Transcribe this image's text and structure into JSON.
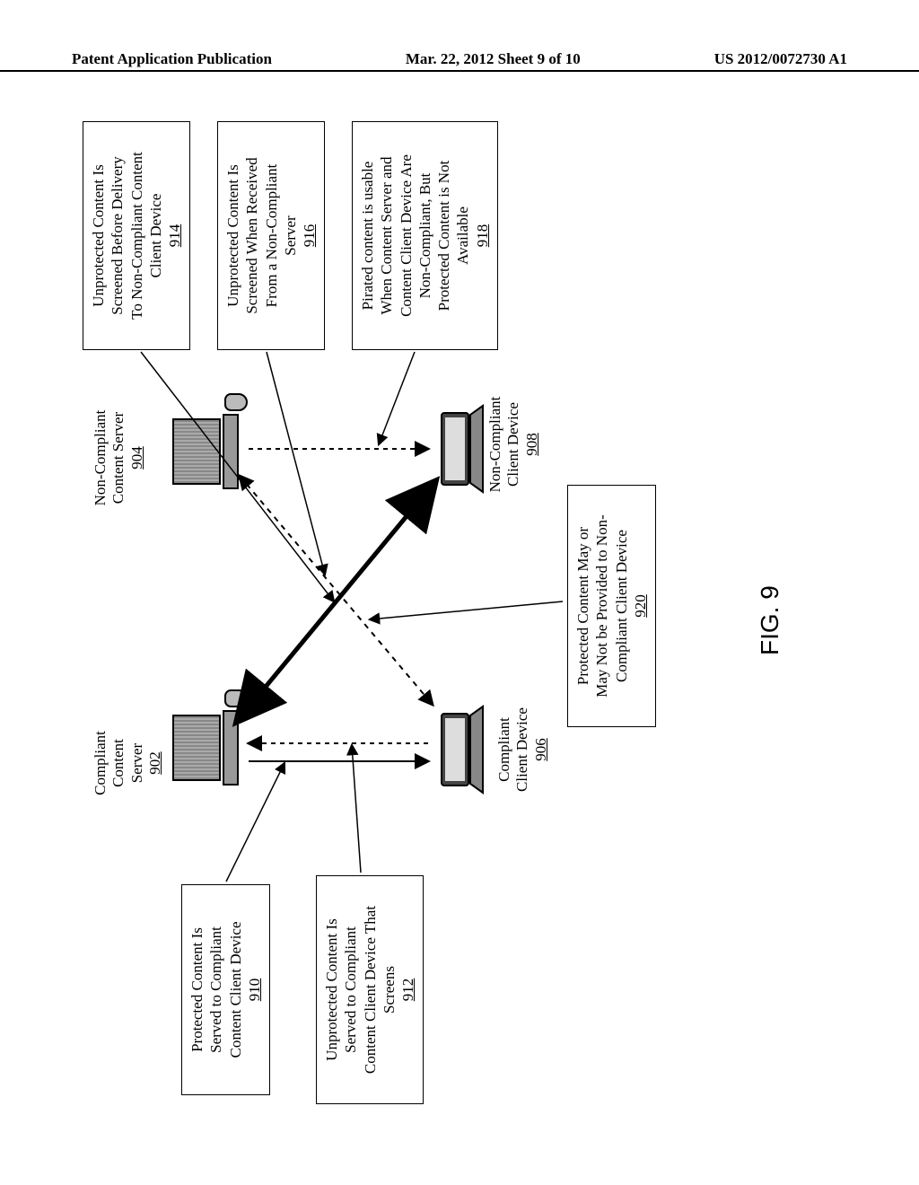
{
  "header": {
    "left": "Patent Application Publication",
    "center": "Mar. 22, 2012  Sheet 9 of 10",
    "right": "US 2012/0072730 A1"
  },
  "figure_label": "FIG. 9",
  "nodes": {
    "compliant_server": {
      "label": "Compliant\nContent\nServer",
      "ref": "902"
    },
    "noncompliant_server": {
      "label": "Non-Compliant\nContent Server",
      "ref": "904"
    },
    "compliant_client": {
      "label": "Compliant\nClient Device",
      "ref": "906"
    },
    "noncompliant_client": {
      "label": "Non-Compliant\nClient Device",
      "ref": "908"
    }
  },
  "boxes": {
    "b910": {
      "lines": [
        "Protected Content Is",
        "Served to Compliant",
        "Content Client Device"
      ],
      "ref": "910"
    },
    "b912": {
      "lines": [
        "Unprotected Content Is",
        "Served to Compliant",
        "Content Client Device That",
        "Screens"
      ],
      "ref": "912"
    },
    "b914": {
      "lines": [
        "Unprotected Content Is",
        "Screened Before Delivery",
        "To Non-Compliant Content",
        "Client Device"
      ],
      "ref": "914"
    },
    "b916": {
      "lines": [
        "Unprotected Content Is",
        "Screened When Received",
        "From a Non-Compliant",
        "Server"
      ],
      "ref": "916"
    },
    "b918": {
      "lines": [
        "Pirated content is usable",
        "When Content Server and",
        "Content Client Device Are",
        "Non-Compliant, But",
        "Protected Content is Not",
        "Available"
      ],
      "ref": "918"
    },
    "b920": {
      "lines": [
        "Protected Content May or",
        "May Not be Provided to Non-",
        "Compliant Client Device"
      ],
      "ref": "920"
    }
  }
}
